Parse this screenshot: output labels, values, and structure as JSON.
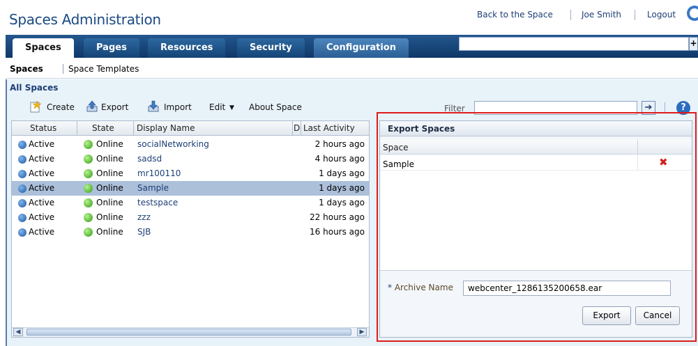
{
  "header": {
    "app_title": "Spaces Administration",
    "links": [
      "Back to the Space",
      "Joe Smith",
      "Logout"
    ]
  },
  "tabs": [
    "Spaces",
    "Pages",
    "Resources",
    "Security",
    "Configuration"
  ],
  "subnav": [
    "Spaces",
    "Space Templates"
  ],
  "main": {
    "section_title": "All Spaces",
    "toolbar": {
      "create": "Create",
      "export": "Export",
      "import": "Import",
      "edit": "Edit",
      "about": "About Space"
    },
    "filter_label": "Filter",
    "columns": [
      "Status",
      "State",
      "Display Name",
      "De",
      "Last Activity"
    ],
    "rows": [
      {
        "status": "Active",
        "state": "Online",
        "name": "socialNetworking",
        "last": "2 hours ago"
      },
      {
        "status": "Active",
        "state": "Online",
        "name": "sadsd",
        "last": "4 hours ago"
      },
      {
        "status": "Active",
        "state": "Online",
        "name": "mr100110",
        "last": "1 days ago"
      },
      {
        "status": "Active",
        "state": "Online",
        "name": "Sample",
        "last": "1 days ago"
      },
      {
        "status": "Active",
        "state": "Online",
        "name": "testspace",
        "last": "1 days ago"
      },
      {
        "status": "Active",
        "state": "Online",
        "name": "zzz",
        "last": "22 hours ago"
      },
      {
        "status": "Active",
        "state": "Online",
        "name": "SJB",
        "last": "16 hours ago"
      }
    ]
  },
  "dialog": {
    "title": "Export Spaces",
    "column": "Space",
    "rows": [
      "Sample"
    ],
    "archive_label": "Archive Name",
    "required_mark": "*",
    "archive_value": "webcenter_1286135200658.ear",
    "export_button": "Export",
    "cancel_button": "Cancel"
  },
  "colors": {
    "accent": "#1b4a84",
    "highlight_border": "#e01b1b",
    "selected_row": "#acc0da"
  }
}
